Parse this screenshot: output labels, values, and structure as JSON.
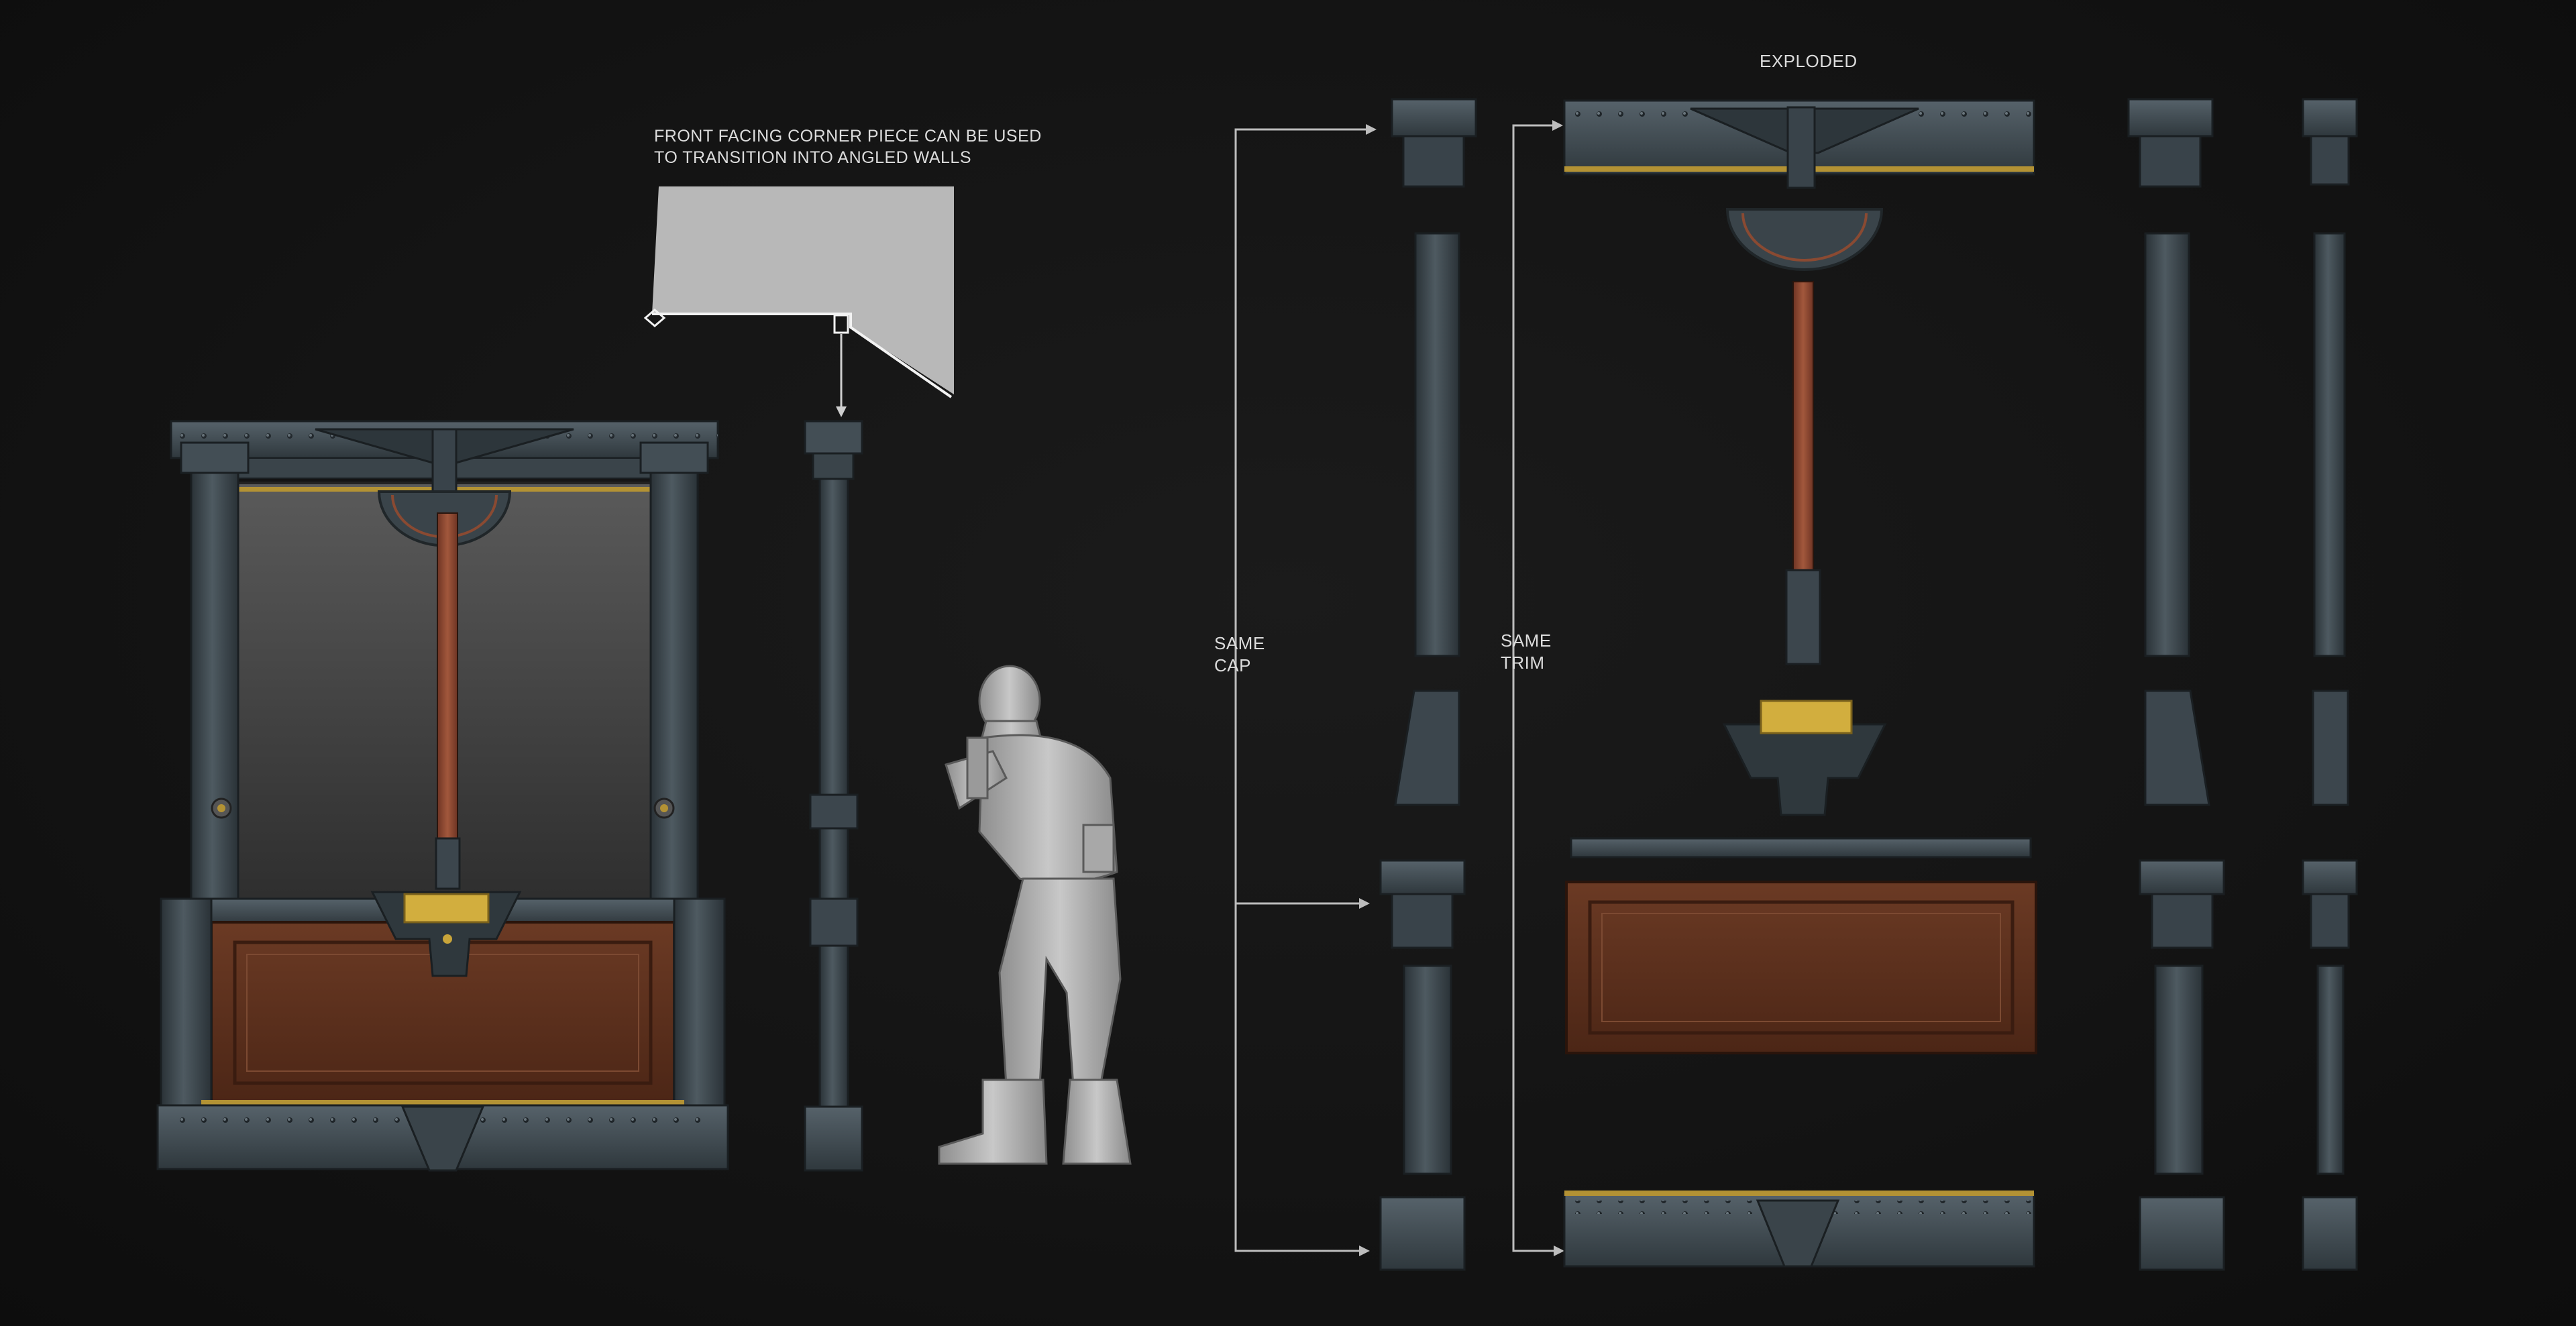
{
  "labels": {
    "exploded": "EXPLODED",
    "note_line1": "FRONT FACING CORNER PIECE CAN BE USED",
    "note_line2": "TO TRANSITION INTO ANGLED WALLS",
    "same_cap_line1": "SAME",
    "same_cap_line2": "CAP",
    "same_trim_line1": "SAME",
    "same_trim_line2": "TRIM"
  },
  "colors": {
    "background": "#141414",
    "metal": "#3c464d",
    "metal_light": "#56626a",
    "metal_dark": "#252c31",
    "wood": "#5a2f1c",
    "wood_light": "#72402a",
    "brass": "#c9a53a",
    "copper_rod": "#8a4a32",
    "glass": "#4a4a4a",
    "figure": "#b9b9b9",
    "line": "#bdbdbd"
  },
  "icons": [
    "kiosk-assembled",
    "corner-pillar",
    "soldier-figure",
    "top-view-diagram",
    "exploded-parts"
  ]
}
